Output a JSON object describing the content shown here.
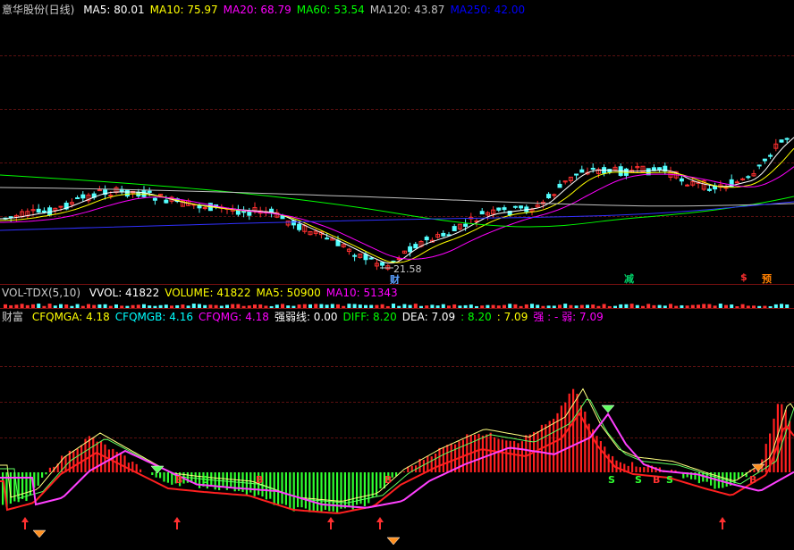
{
  "main": {
    "title": "意华股份(日线)",
    "ma": [
      {
        "label": "MA5: 80.01",
        "color": "#ffffff"
      },
      {
        "label": "MA10: 75.97",
        "color": "#ffff00"
      },
      {
        "label": "MA20: 68.79",
        "color": "#ff00ff"
      },
      {
        "label": "MA60: 53.54",
        "color": "#00ff00"
      },
      {
        "label": "MA120: 43.87",
        "color": "#c0c0c0"
      },
      {
        "label": "MA250: 42.00",
        "color": "#0000ff"
      }
    ],
    "low_label": "21.58",
    "markers": {
      "cai": "财",
      "jian": "减",
      "dollar": "$",
      "yu": "预"
    }
  },
  "volume": {
    "title": "VOL-TDX(5,10)",
    "vals": [
      {
        "label": "VVOL: 41822",
        "color": "#ffffff"
      },
      {
        "label": "VOLUME: 41822",
        "color": "#ffff00"
      },
      {
        "label": "MA5: 50900",
        "color": "#ffff00"
      },
      {
        "label": "MA10: 51343",
        "color": "#ff00ff"
      }
    ]
  },
  "indicator": {
    "title": "财富",
    "vals": [
      {
        "label": "CFQMGA: 4.18",
        "color": "#ffff00"
      },
      {
        "label": "CFQMGB: 4.16",
        "color": "#00ffff"
      },
      {
        "label": "CFQMG: 4.18",
        "color": "#ff00ff"
      },
      {
        "label": "强弱线: 0.00",
        "color": "#ffffff"
      },
      {
        "label": "DIFF: 8.20",
        "color": "#00ff00"
      },
      {
        "label": "DEA: 7.09",
        "color": "#ffffff"
      },
      {
        "label": ": 8.20",
        "color": "#00ff00"
      },
      {
        "label": ": 7.09",
        "color": "#ffff00"
      },
      {
        "label": "强 : - 弱: 7.09",
        "color": "#ff00ff"
      }
    ],
    "buy_sell": {
      "b": "B",
      "s": "S"
    }
  }
}
